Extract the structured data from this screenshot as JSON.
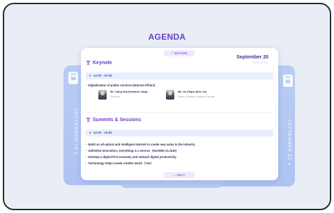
{
  "agenda": {
    "title": "AGENDA",
    "before_label": "⌃ BEFORE",
    "next_label": "⌄ NEXT",
    "left_card": {
      "badge_month": "SEP",
      "badge_day": "19",
      "vertical_label": "SEPTEMBER 19 ∧"
    },
    "right_card": {
      "badge_month": "SEP",
      "badge_day": "21",
      "vertical_label": "SEPTEMBER 21 ∨"
    },
    "date": "September 20",
    "date_sub": "Opening Day",
    "keynote": {
      "heading": "Keynote",
      "time": "14:00 - 15:45",
      "topic": "Digitalization of public services (Internal Affairs)",
      "speakers": [
        {
          "name": "Mr. Liang Hua (Howard Liang)",
          "role": "Chairman"
        },
        {
          "name": "Ms. Xu Zhijun (Eric Xu)",
          "role": "Deputy Chairman, Rotating Chairman"
        }
      ]
    },
    "summits": {
      "heading": "Summits & Sessions",
      "time": "14:00 - 15:50",
      "items": [
        "Build an all-optical and intelligent Internet to create new value in the industry",
        "Unlimited innovation, everything is a service（HUAWEI CLOUD）",
        "Develop a digital-first economy and unleash digital productivity",
        "Technology helps create a better world（T4A）"
      ]
    }
  },
  "icons": {
    "podium": "podium-icon",
    "clock": "clock-icon"
  },
  "colors": {
    "accent": "#6a3cc6",
    "card_blue": "#b8ccf3",
    "background": "#e9edf6"
  }
}
